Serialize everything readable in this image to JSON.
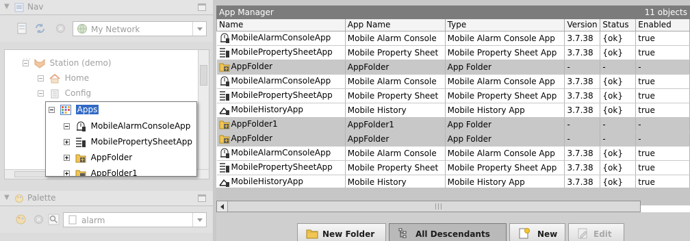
{
  "nav": {
    "title": "Nav",
    "network_label": "My Network",
    "tree": {
      "station": "Station (demo)",
      "home": "Home",
      "config": "Config"
    },
    "popup": {
      "apps": "Apps",
      "items": [
        "MobileAlarmConsoleApp",
        "MobilePropertySheetApp",
        "AppFolder",
        "AppFolder1"
      ]
    }
  },
  "palette": {
    "title": "Palette",
    "search_value": "alarm"
  },
  "app_manager": {
    "title": "App Manager",
    "count": "11 objects",
    "columns": [
      "Name",
      "App Name",
      "Type",
      "Version",
      "Status",
      "Enabled"
    ],
    "rows": [
      {
        "icon": "alarm-icon",
        "name": "MobileAlarmConsoleApp",
        "app_name": "Mobile Alarm Console",
        "type": "Mobile Alarm Console App",
        "version": "3.7.38",
        "status": "{ok}",
        "enabled": "true",
        "folder": false
      },
      {
        "icon": "property-sheet-icon",
        "name": "MobilePropertySheetApp",
        "app_name": "Mobile Property Sheet",
        "type": "Mobile Property Sheet App",
        "version": "3.7.38",
        "status": "{ok}",
        "enabled": "true",
        "folder": false
      },
      {
        "icon": "app-folder-icon",
        "name": "AppFolder",
        "app_name": "AppFolder",
        "type": "App Folder",
        "version": "-",
        "status": "-",
        "enabled": "-",
        "folder": true
      },
      {
        "icon": "alarm-icon",
        "name": "MobileAlarmConsoleApp",
        "app_name": "Mobile Alarm Console",
        "type": "Mobile Alarm Console App",
        "version": "3.7.38",
        "status": "{ok}",
        "enabled": "true",
        "folder": false
      },
      {
        "icon": "property-sheet-icon",
        "name": "MobilePropertySheetApp",
        "app_name": "Mobile Property Sheet",
        "type": "Mobile Property Sheet App",
        "version": "3.7.38",
        "status": "{ok}",
        "enabled": "true",
        "folder": false
      },
      {
        "icon": "history-icon",
        "name": "MobileHistoryApp",
        "app_name": "Mobile History",
        "type": "Mobile History App",
        "version": "3.7.38",
        "status": "{ok}",
        "enabled": "true",
        "folder": false
      },
      {
        "icon": "app-folder-icon",
        "name": "AppFolder1",
        "app_name": "AppFolder1",
        "type": "App Folder",
        "version": "-",
        "status": "-",
        "enabled": "-",
        "folder": true
      },
      {
        "icon": "app-folder-icon",
        "name": "AppFolder",
        "app_name": "AppFolder",
        "type": "App Folder",
        "version": "-",
        "status": "-",
        "enabled": "-",
        "folder": true
      },
      {
        "icon": "alarm-icon",
        "name": "MobileAlarmConsoleApp",
        "app_name": "Mobile Alarm Console",
        "type": "Mobile Alarm Console App",
        "version": "3.7.38",
        "status": "{ok}",
        "enabled": "true",
        "folder": false
      },
      {
        "icon": "property-sheet-icon",
        "name": "MobilePropertySheetApp",
        "app_name": "Mobile Property Sheet",
        "type": "Mobile Property Sheet App",
        "version": "3.7.38",
        "status": "{ok}",
        "enabled": "true",
        "folder": false
      },
      {
        "icon": "history-icon",
        "name": "MobileHistoryApp",
        "app_name": "Mobile History",
        "type": "Mobile History App",
        "version": "3.7.38",
        "status": "{ok}",
        "enabled": "true",
        "folder": false
      }
    ]
  },
  "buttons": {
    "new_folder": "New Folder",
    "all_descendants": "All Descendants",
    "new": "New",
    "edit": "Edit"
  },
  "colors": {
    "selection": "#316ac5",
    "title_bar": "#7c7c7c",
    "folder_row": "#c8c8c8"
  }
}
